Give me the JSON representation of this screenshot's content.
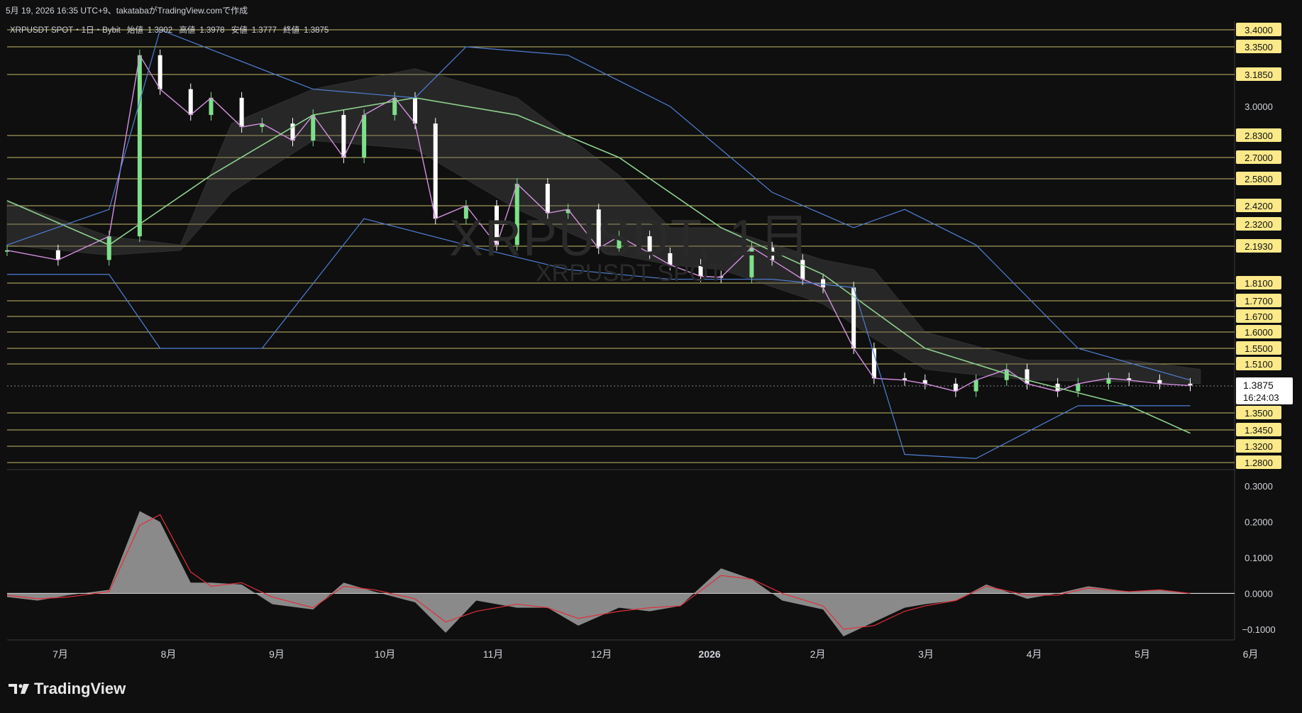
{
  "header": {
    "created_text": "5月 19, 2026 16:35 UTC+9、takatabaがTradingView.comで作成",
    "symbol_line": "XRPUSDT SPOT・1日・Bybit",
    "ohlc": [
      {
        "label": "始値",
        "value": "1.3902"
      },
      {
        "label": "高値",
        "value": "1.3978"
      },
      {
        "label": "安値",
        "value": "1.3777"
      },
      {
        "label": "終値",
        "value": "1.3875"
      }
    ]
  },
  "watermark": {
    "main": "XRPUSDT, 1日",
    "sub": "XRPUSDT SPOT"
  },
  "brand": {
    "name": "TradingView"
  },
  "colors": {
    "background": "#0f0f0f",
    "up_candle": "#7ee08a",
    "down_candle": "#ffffff",
    "level_line": "#e6d77a",
    "bollinger": "#4f7fd6",
    "ma_fast": "#d48fe0",
    "ma_mid": "#4fa3f0",
    "ma_slow": "#8ed08e",
    "cloud": "#555555",
    "macd_hist": "#a0a0a0",
    "macd_signal": "#e0303a"
  },
  "chart_data": [
    {
      "type": "line",
      "title": "XRPUSDT SPOT・1日・Bybit",
      "ylim": [
        1.28,
        3.45
      ],
      "grid": false,
      "x_ticks": [
        "7月",
        "8月",
        "9月",
        "10月",
        "11月",
        "12月",
        "2026",
        "2月",
        "3月",
        "4月",
        "5月",
        "6月"
      ],
      "y_tick_labels": [
        "3.0000"
      ],
      "current_price": {
        "value": "1.3875",
        "countdown": "16:24:03"
      },
      "horizontal_levels": [
        3.4,
        3.35,
        3.185,
        2.83,
        2.7,
        2.58,
        2.42,
        2.32,
        2.193,
        1.81,
        1.77,
        1.67,
        1.6,
        1.55,
        1.51,
        1.35,
        1.345,
        1.32,
        1.28
      ],
      "level_labels": [
        "3.4000",
        "3.3500",
        "3.1850",
        "2.8300",
        "2.7000",
        "2.5800",
        "2.4200",
        "2.3200",
        "2.1930",
        "1.8100",
        "1.7700",
        "1.6700",
        "1.6000",
        "1.5500",
        "1.5100",
        "1.3500",
        "1.3450",
        "1.3200",
        "1.2800"
      ],
      "series": [
        {
          "type": "candlestick",
          "x_month": [
            6.0,
            6.5,
            7.0,
            7.3,
            7.5,
            7.8,
            8.0,
            8.3,
            8.5,
            8.8,
            9.0,
            9.3,
            9.5,
            9.8,
            10.0,
            10.2,
            10.5,
            10.8,
            11.0,
            11.3,
            11.5,
            11.8,
            12.0,
            12.3,
            12.5,
            12.8,
            13.0,
            13.3,
            13.5,
            13.8,
            14.0,
            14.3,
            14.5,
            14.8,
            15.0,
            15.3,
            15.5,
            15.8,
            16.0,
            16.3,
            16.5,
            16.8,
            17.0,
            17.3,
            17.6
          ],
          "close": [
            2.15,
            2.05,
            2.25,
            3.3,
            3.1,
            2.95,
            3.05,
            2.88,
            2.9,
            2.8,
            2.95,
            2.7,
            2.95,
            3.05,
            2.9,
            2.35,
            2.42,
            2.2,
            2.55,
            2.38,
            2.4,
            2.17,
            2.25,
            2.12,
            2.0,
            1.88,
            1.87,
            2.18,
            2.05,
            1.85,
            1.8,
            1.55,
            1.43,
            1.42,
            1.4,
            1.38,
            1.42,
            1.48,
            1.4,
            1.38,
            1.4,
            1.43,
            1.42,
            1.4,
            1.39
          ]
        }
      ]
    },
    {
      "type": "area",
      "title": "",
      "ylim": [
        -0.13,
        0.33
      ],
      "y_tick_labels": [
        "0.3000",
        "0.2000",
        "0.1000",
        "0.0000",
        "−0.1000"
      ],
      "series": [
        {
          "name": "histogram",
          "x_month": [
            6.0,
            6.3,
            6.6,
            7.0,
            7.3,
            7.5,
            7.8,
            8.0,
            8.3,
            8.6,
            9.0,
            9.3,
            9.6,
            10.0,
            10.3,
            10.6,
            11.0,
            11.3,
            11.6,
            12.0,
            12.3,
            12.6,
            13.0,
            13.3,
            13.6,
            14.0,
            14.2,
            14.5,
            14.8,
            15.0,
            15.3,
            15.6,
            16.0,
            16.3,
            16.6,
            17.0,
            17.3,
            17.6
          ],
          "values": [
            -0.01,
            -0.02,
            -0.005,
            0.01,
            0.23,
            0.2,
            0.03,
            0.03,
            0.025,
            -0.03,
            -0.045,
            0.03,
            0.005,
            -0.025,
            -0.11,
            -0.02,
            -0.04,
            -0.04,
            -0.09,
            -0.04,
            -0.05,
            -0.035,
            0.07,
            0.04,
            -0.02,
            -0.045,
            -0.12,
            -0.08,
            -0.04,
            -0.03,
            -0.02,
            0.025,
            -0.015,
            0.0,
            0.02,
            0.005,
            0.01,
            0.0
          ]
        },
        {
          "name": "signal",
          "x_month": [
            6.0,
            6.3,
            6.6,
            7.0,
            7.3,
            7.5,
            7.8,
            8.0,
            8.3,
            8.6,
            9.0,
            9.3,
            9.6,
            10.0,
            10.3,
            10.6,
            11.0,
            11.3,
            11.6,
            12.0,
            12.3,
            12.6,
            13.0,
            13.3,
            13.6,
            14.0,
            14.2,
            14.5,
            14.8,
            15.0,
            15.3,
            15.6,
            16.0,
            16.3,
            16.6,
            17.0,
            17.3,
            17.6
          ],
          "values": [
            -0.005,
            -0.015,
            -0.01,
            0.005,
            0.19,
            0.22,
            0.06,
            0.02,
            0.03,
            -0.01,
            -0.04,
            0.02,
            0.01,
            -0.015,
            -0.08,
            -0.05,
            -0.03,
            -0.04,
            -0.07,
            -0.05,
            -0.04,
            -0.035,
            0.05,
            0.04,
            0.0,
            -0.035,
            -0.1,
            -0.09,
            -0.05,
            -0.035,
            -0.02,
            0.02,
            -0.005,
            -0.005,
            0.015,
            0.005,
            0.01,
            0.0
          ]
        }
      ]
    }
  ]
}
